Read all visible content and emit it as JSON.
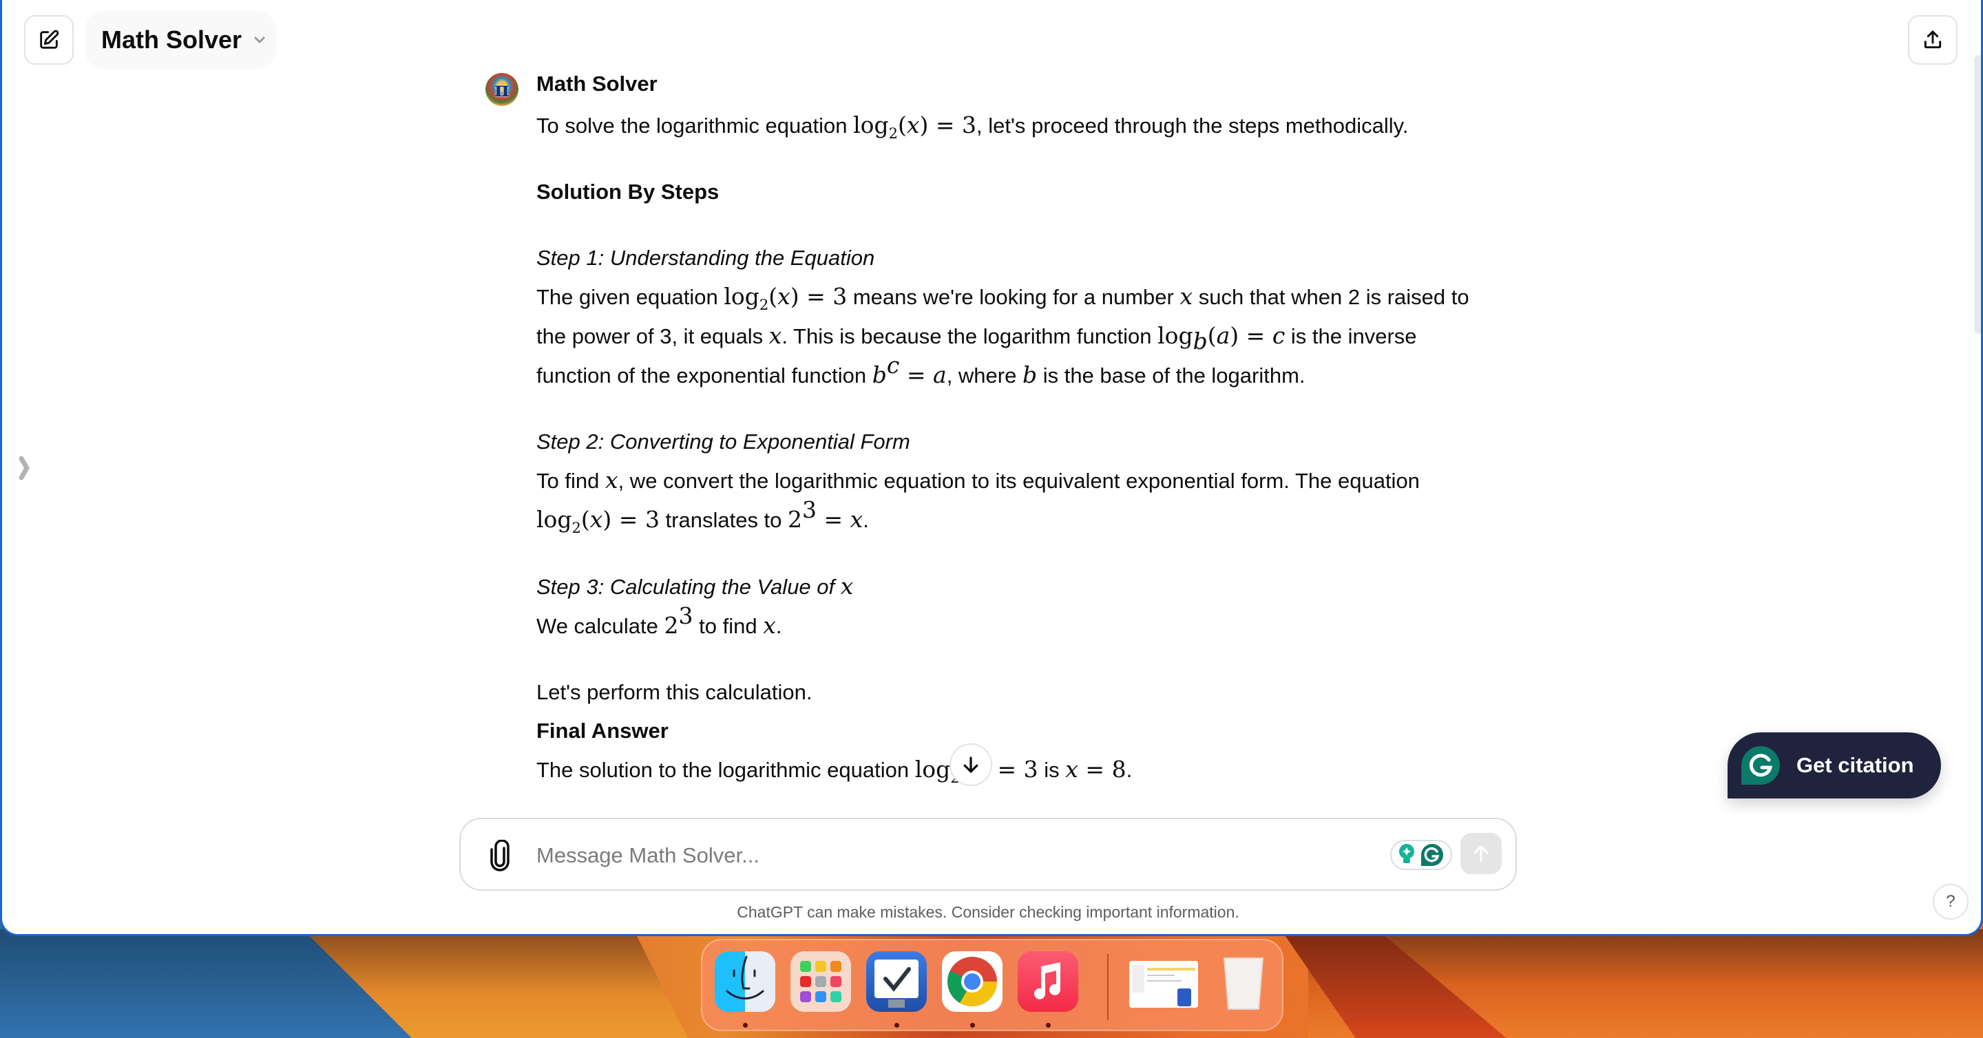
{
  "header": {
    "title": "Math Solver",
    "new_chat_icon": "edit-icon",
    "share_icon": "share-icon",
    "title_chevron_icon": "chevron-down-icon"
  },
  "sidebar": {
    "toggle_icon": "chevron-right-icon"
  },
  "message": {
    "author": "Math Solver",
    "avatar_glyph": "π",
    "intro_before": "To solve the logarithmic equation ",
    "intro_after": ", let's proceed through the steps methodically.",
    "section_title": "Solution By Steps",
    "step1_title": "Step 1: Understanding the Equation",
    "step1_a": "The given equation ",
    "step1_b": " means we're looking for a number ",
    "step1_c": " such that when 2 is raised to the power of 3, it equals ",
    "step1_d": ". This is because the logarithm function ",
    "step1_e": " is the inverse function of the exponential function ",
    "step1_f": ", where ",
    "step1_g": " is the base of the logarithm.",
    "step2_title": "Step 2: Converting to Exponential Form",
    "step2_a": "To find ",
    "step2_b": ", we convert the logarithmic equation to its equivalent exponential form. The equation ",
    "step2_c": " translates to ",
    "step2_d": ".",
    "step3_title": "Step 3: Calculating the Value of ",
    "step3_a": "We calculate ",
    "step3_b": " to find ",
    "step3_c": ".",
    "perform": "Let's perform this calculation.",
    "final_title": "Final Answer",
    "final_a": "The solution to the logarithmic equation ",
    "final_b": " is ",
    "final_c": ".",
    "math": {
      "log": "log",
      "base2": "2",
      "baseb": "b",
      "x": "x",
      "a": "a",
      "b": "b",
      "c": "c",
      "three": "3",
      "two": "2",
      "eight": "8",
      "eq": " = ",
      "lp": "(",
      "rp": ")"
    }
  },
  "scroll_down_icon": "arrow-down-icon",
  "composer": {
    "placeholder": "Message Math Solver...",
    "value": "",
    "attach_icon": "paperclip-icon",
    "send_icon": "arrow-up-icon"
  },
  "disclaimer": "ChatGPT can make mistakes. Consider checking important information.",
  "citation": {
    "label": "Get citation"
  },
  "help": {
    "label": "?"
  },
  "dock": {
    "items": [
      {
        "name": "Finder",
        "running": true
      },
      {
        "name": "Launchpad",
        "running": false
      },
      {
        "name": "Tasks",
        "running": true
      },
      {
        "name": "Chrome",
        "running": true
      },
      {
        "name": "Music",
        "running": true
      },
      {
        "name": "Recent window",
        "running": false
      },
      {
        "name": "Trash",
        "running": false
      }
    ]
  },
  "colors": {
    "citation_bg": "#20233d",
    "grammarly_green": "#0b7a68",
    "window_border": "#1a64d0"
  }
}
